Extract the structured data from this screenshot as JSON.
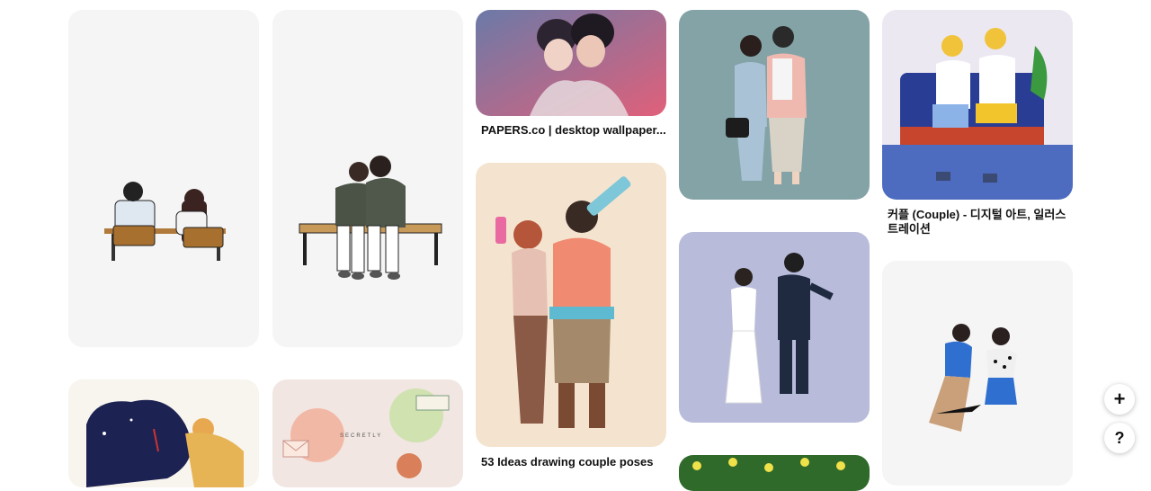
{
  "pins": [
    {
      "id": "pin-1",
      "alt": "couple at school desk illustration"
    },
    {
      "id": "pin-2",
      "alt": "couple on bench illustration"
    },
    {
      "id": "pin-3",
      "alt": "anime couple wallpaper",
      "caption": "PAPERS.co | desktop wallpaper..."
    },
    {
      "id": "pin-4",
      "alt": "water gun couple illustration",
      "caption": "53 Ideas drawing couple poses"
    },
    {
      "id": "pin-5",
      "alt": "fashion couple illustration"
    },
    {
      "id": "pin-6",
      "alt": "wedding couple illustration"
    },
    {
      "id": "pin-7",
      "alt": "green floral pattern"
    },
    {
      "id": "pin-8",
      "alt": "couple ice cream on bench",
      "caption": "커플 (Couple) - 디지털 아트, 일러스트레이션"
    },
    {
      "id": "pin-9",
      "alt": "dancing couple illustration"
    },
    {
      "id": "pin-10",
      "alt": "couple with wine illustration"
    },
    {
      "id": "pin-11",
      "alt": "secretly stationery illustration",
      "text": "SECRETLY"
    }
  ],
  "fab": {
    "add": "+",
    "help": "?"
  },
  "colors": {
    "background": "#ffffff",
    "caption": "#111111"
  }
}
